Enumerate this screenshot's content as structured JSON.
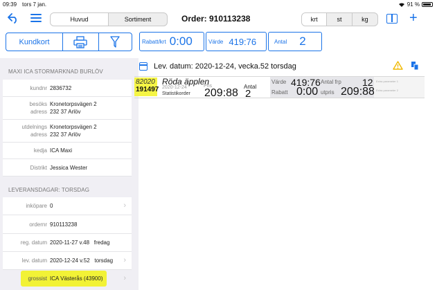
{
  "status_bar": {
    "time": "09:39",
    "date": "tors 7 jan.",
    "battery": "91 %"
  },
  "nav": {
    "tabs": [
      {
        "label": "Huvud",
        "active": true
      },
      {
        "label": "Sortiment",
        "active": false
      }
    ],
    "title": "Order: 910113238",
    "units": [
      {
        "label": "krt",
        "active": true
      },
      {
        "label": "st",
        "active": false
      },
      {
        "label": "kg",
        "active": false
      }
    ]
  },
  "actions": {
    "kundkort_label": "Kundkort"
  },
  "summary": {
    "rabatt_label": "Rabatt/krt",
    "rabatt_value": "0:00",
    "varde_label": "Värde",
    "varde_value": "419:76",
    "antal_label": "Antal",
    "antal_value": "2"
  },
  "customer": {
    "heading": "MAXI ICA STORMARKNAD BURLÖV",
    "kundnr_label": "kundnr",
    "kundnr": "2836732",
    "besoks_label_1": "besöks",
    "besoks_label_2": "adress",
    "besoks_line1": "Kronetorpsvägen 2",
    "besoks_line2": "232 37 Arlöv",
    "utd_label_1": "utdelnings",
    "utd_label_2": "adress",
    "utd_line1": "Kronetorpsvägen 2",
    "utd_line2": "232 37 Arlöv",
    "kedja_label": "kedja",
    "kedja": "ICA Maxi",
    "distrikt_label": "Distrikt",
    "distrikt": "Jessica Wester"
  },
  "delivery": {
    "heading": "LEVERANSDAGAR: TORSDAG",
    "inkopare_label": "inköpare",
    "inkopare": "0",
    "ordernr_label": "ordernr",
    "ordernr": "910113238",
    "reg_label": "reg. datum",
    "reg_value": "2020-11-27 v.48   fredag",
    "lev_label": "lev. datum",
    "lev_value": "2020-12-24 v.52   torsdag",
    "grossist_label": "grossist",
    "grossist": "ICA Västerås (43900)"
  },
  "lev_header": "Lev. datum: 2020-12-24, vecka.52  torsdag",
  "product": {
    "code1": "82020",
    "code2": "191497",
    "name": "Röda äpplen",
    "date": "2020-12-24",
    "type": "Statistikorder",
    "pris_label": "Pris",
    "pris": "209:88",
    "antal_label": "Antal",
    "antal": "2",
    "varde_label": "Värde",
    "varde": "419:76",
    "antal_frp_label": "Antal frp",
    "antal_frp": "12",
    "rabatt_label": "Rabatt",
    "rabatt": "0:00",
    "utpris_label": "utpris",
    "utpris": "209:88",
    "extra1": "Extra parameter 1",
    "extra2": "Extra parameter 2"
  },
  "colors": {
    "accent": "#1a73e8",
    "highlight": "#f2f236",
    "warning": "#f0b800"
  }
}
